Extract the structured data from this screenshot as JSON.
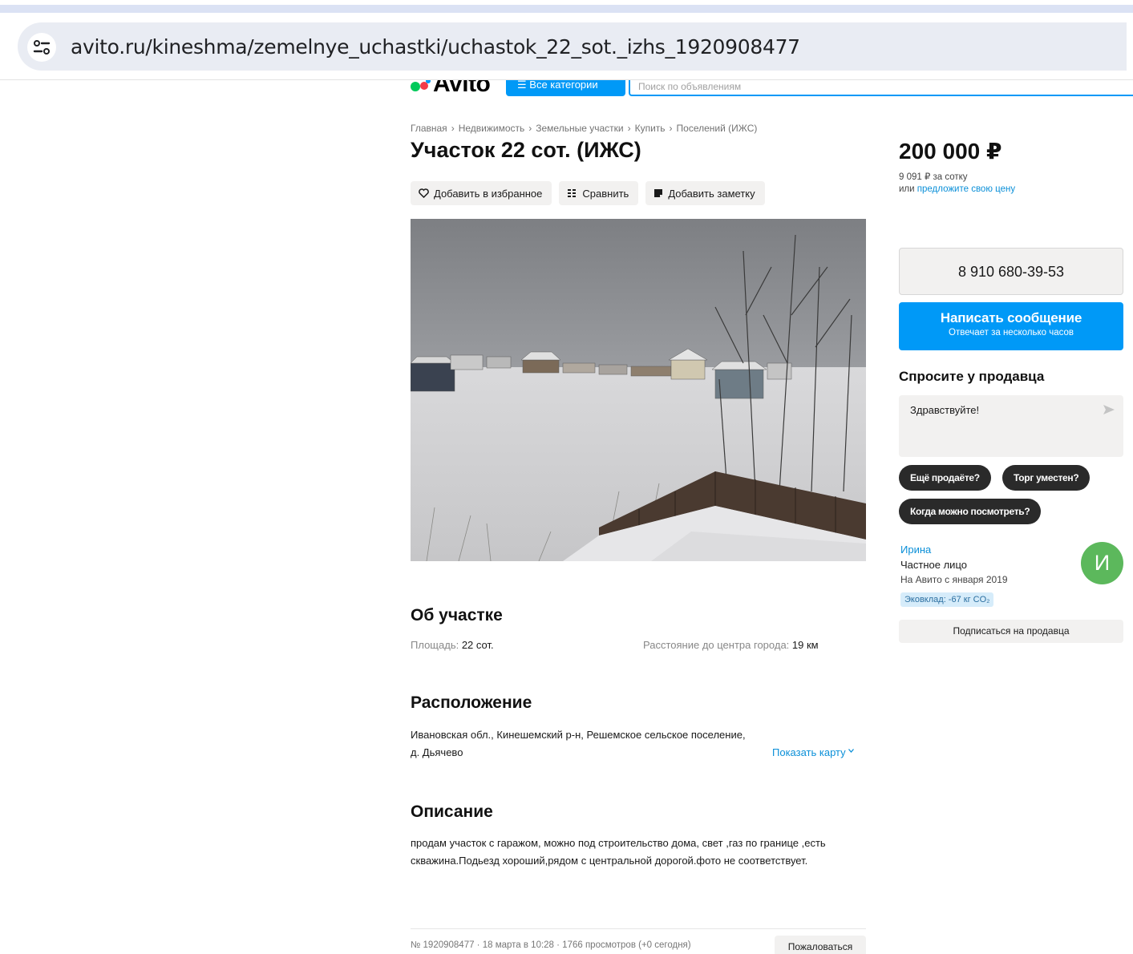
{
  "browser": {
    "url": "avito.ru/kineshma/zemelnye_uchastki/uchastok_22_sot._izhs_1920908477"
  },
  "header": {
    "logo_text": "Avito",
    "all_categories_label": "Все категории",
    "search_placeholder": "Поиск по объявлениям",
    "brand_color": "#0099f7"
  },
  "breadcrumbs": [
    "Главная",
    "Недвижимость",
    "Земельные участки",
    "Купить",
    "Поселений (ИЖС)"
  ],
  "listing": {
    "title": "Участок 22 сот. (ИЖС)",
    "actions": {
      "favorite": "Добавить в избранное",
      "compare": "Сравнить",
      "note": "Добавить заметку"
    },
    "about": {
      "heading": "Об участке",
      "area_label": "Площадь:",
      "area_value": "22 сот.",
      "distance_label": "Расстояние до центра города:",
      "distance_value": "19 км"
    },
    "location": {
      "heading": "Расположение",
      "address": "Ивановская обл., Кинешемский р-н, Решемское сельское поселение, д. Дьячево",
      "show_map": "Показать карту"
    },
    "description": {
      "heading": "Описание",
      "text": "продам участок с гаражом, можно под строительство дома, свет ,газ по границе ,есть скважина.Подьезд хороший,рядом с центральной дорогой.фото не соответствует."
    },
    "meta": "№ 1920908477 · 18 марта в 10:28 · 1766 просмотров (+0 сегодня)",
    "report_label": "Пожаловаться"
  },
  "sidebar": {
    "price": "200 000 ₽",
    "price_per_unit": "9 091 ₽ за сотку",
    "offer_prefix": "или",
    "offer_link": "предложите свою цену",
    "phone": "8 910 680-39-53",
    "message_button": "Написать сообщение",
    "message_sub": "Отвечает за несколько часов",
    "ask_title": "Спросите у продавца",
    "ask_text": "Здравствуйте!",
    "quick_questions": [
      "Ещё продаёте?",
      "Торг уместен?",
      "Когда можно посмотреть?"
    ],
    "seller": {
      "name": "Ирина",
      "type": "Частное лицо",
      "since": "На Авито с января 2019",
      "eco": "Эковклад: -67 кг CO₂",
      "avatar_letter": "И",
      "avatar_color": "#5cb85c"
    },
    "subscribe_label": "Подписаться на продавца"
  }
}
